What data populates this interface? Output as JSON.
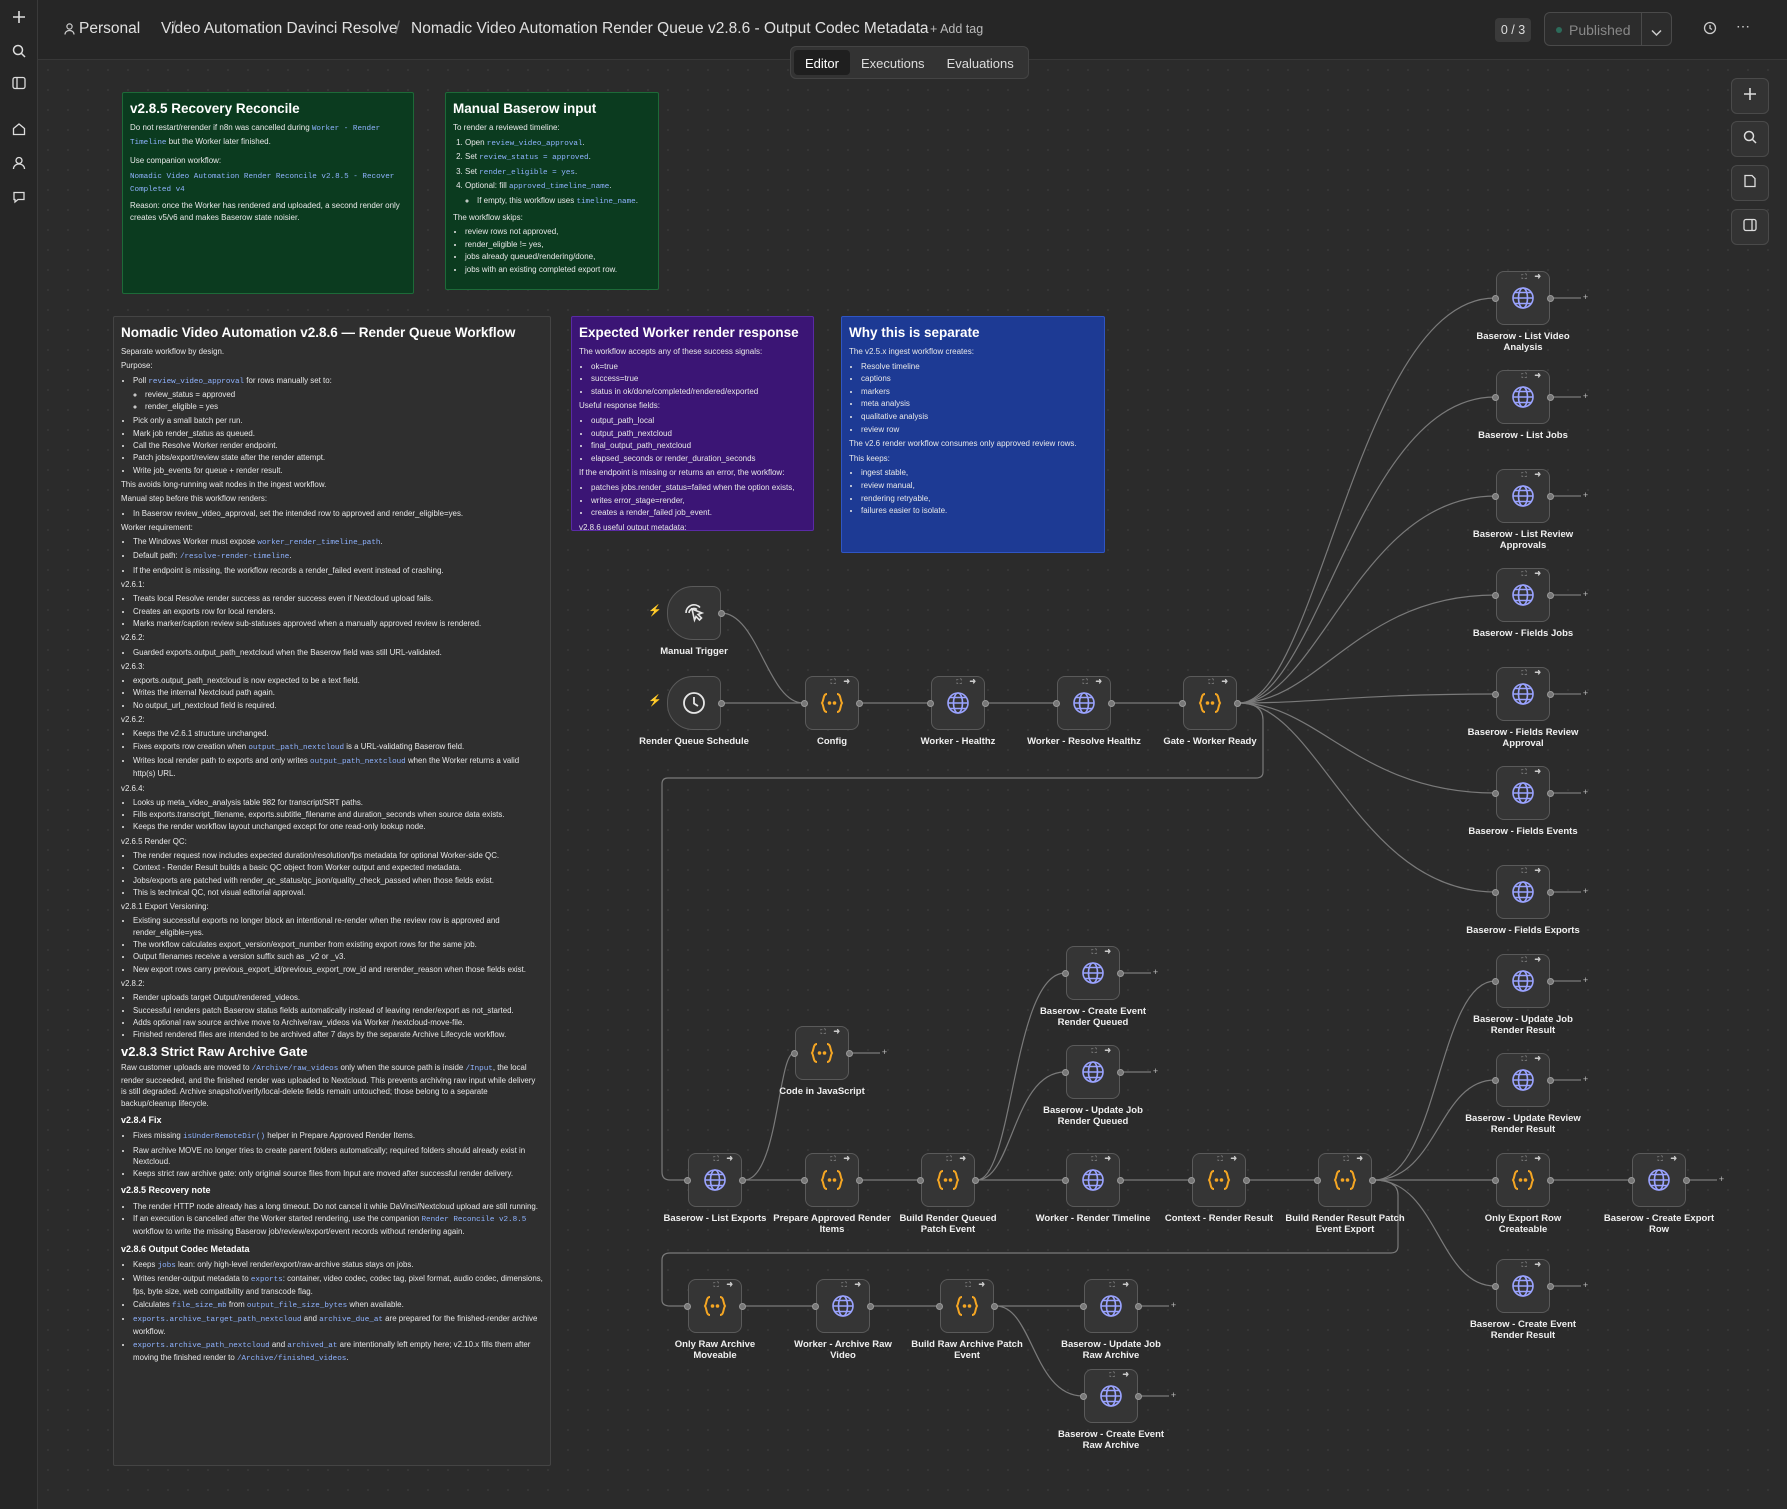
{
  "header": {
    "workspace": "Personal",
    "project": "Video Automation Davinci Resolve",
    "workflow_title": "Nomadic Video Automation Render Queue v2.8.6 - Output Codec Metadata",
    "add_tag": "+ Add tag",
    "counter": "0 / 3",
    "published": "Published"
  },
  "tabs": [
    "Editor",
    "Executions",
    "Evaluations"
  ],
  "sidebar_icons": [
    "plus-icon",
    "search-icon",
    "panel-icon",
    "home-icon",
    "user-icon",
    "chat-icon"
  ],
  "right_toolbar_icons": [
    "plus-icon",
    "search-icon",
    "sticky-note-icon",
    "panel-right-icon"
  ],
  "colors": {
    "green_note": "#0b3b1f",
    "purple_note": "#3b1575",
    "blue_note": "#1d3a94",
    "dark_note": "#2f2f2f",
    "code_icon": "#f5a623",
    "http_icon": "#9aa3ff"
  },
  "notes": {
    "recovery": {
      "title": "v2.8.5 Recovery Reconcile",
      "p1a": "Do not restart/rerender if n8n was cancelled during ",
      "p1code": "Worker - Render Timeline",
      "p1b": " but the Worker later finished.",
      "p2": "Use companion workflow:",
      "p2code": "Nomadic Video Automation Render Reconcile v2.8.5 - Recover Completed v4",
      "p3": "Reason: once the Worker has rendered and uploaded, a second render only creates v5/v6 and makes Baserow state noisier."
    },
    "manual": {
      "title": "Manual Baserow input",
      "intro": "To render a reviewed timeline:",
      "steps": [
        [
          "Open ",
          "review_video_approval",
          "."
        ],
        [
          "Set ",
          "review_status = approved",
          "."
        ],
        [
          "Set ",
          "render_eligible = yes",
          "."
        ],
        [
          "Optional: fill ",
          "approved_timeline_name",
          "."
        ]
      ],
      "sub": [
        "If empty, this workflow uses ",
        "timeline_name",
        "."
      ],
      "skips_title": "The workflow skips:",
      "skips": [
        "review rows not approved,",
        "render_eligible != yes,",
        "jobs already queued/rendering/done,",
        "jobs with an existing completed export row."
      ]
    },
    "expected": {
      "title": "Expected Worker render response",
      "intro": "The workflow accepts any of these success signals:",
      "signals": [
        "ok=true",
        "success=true",
        "status in ok/done/completed/rendered/exported"
      ],
      "fields_title": "Useful response fields:",
      "fields": [
        "output_path_local",
        "output_path_nextcloud",
        "final_output_path_nextcloud",
        "elapsed_seconds or render_duration_seconds"
      ],
      "error_title": "If the endpoint is missing or returns an error, the workflow:",
      "errors": [
        "patches jobs.render_status=failed when the option exists,",
        "writes error_stage=render,",
        "creates a render_failed job_event."
      ],
      "tail": "v2.8.6 useful output metadata:"
    },
    "why": {
      "title": "Why this is separate",
      "intro": "The v2.5.x ingest workflow creates:",
      "creates": [
        "Resolve timeline",
        "captions",
        "markers",
        "meta analysis",
        "qualitative analysis",
        "review row"
      ],
      "consumes": "The v2.6 render workflow consumes only approved review rows.",
      "keeps_title": "This keeps:",
      "keeps": [
        "ingest stable,",
        "review manual,",
        "rendering retryable,",
        "failures easier to isolate."
      ]
    },
    "main": {
      "title": "Nomadic Video Automation v2.8.6 — Render Queue Workflow",
      "separate": "Separate workflow by design.",
      "purpose": "Purpose:",
      "poll_a": "Poll ",
      "poll_code": "review_video_approval",
      "poll_b": " for rows manually set to:",
      "poll_sub": [
        "review_status = approved",
        "render_eligible = yes"
      ],
      "purpose_items": [
        "Pick only a small batch per run.",
        "Mark job render_status as queued.",
        "Call the Resolve Worker render endpoint.",
        "Patch jobs/export/review state after the render attempt.",
        "Write job_events for queue + render result."
      ],
      "avoids": "This avoids long-running wait nodes in the ingest workflow.",
      "manual_step": "Manual step before this workflow renders:",
      "manual_items": [
        "In Baserow review_video_approval, set the intended row to approved and render_eligible=yes."
      ],
      "worker_req": "Worker requirement:",
      "wr1a": "The Windows Worker must expose ",
      "wr1code": "worker_render_timeline_path",
      "wr1b": ".",
      "wr2a": "Default path: ",
      "wr2code": "/resolve-render-timeline",
      "wr2b": ".",
      "wr3": "If the endpoint is missing, the workflow records a render_failed event instead of crashing.",
      "v261_title": "v2.6.1:",
      "v261": [
        "Treats local Resolve render success as render success even if Nextcloud upload fails.",
        "Creates an exports row for local renders.",
        "Marks marker/caption review sub-statuses approved when a manually approved review is rendered."
      ],
      "v262a_title": "v2.6.2:",
      "v262a": [
        "Guarded exports.output_path_nextcloud when the Baserow field was still URL-validated."
      ],
      "v263_title": "v2.6.3:",
      "v263": [
        "exports.output_path_nextcloud is now expected to be a text field.",
        "Writes the internal Nextcloud path again.",
        "No output_url_nextcloud field is required."
      ],
      "v262b_title": "v2.6.2:",
      "v262b1": "Keeps the v2.6.1 structure unchanged.",
      "v262b2a": "Fixes exports row creation when ",
      "v262b2code": "output_path_nextcloud",
      "v262b2b": " is a URL-validating Baserow field.",
      "v262b3a": "Writes local render path to exports and only writes ",
      "v262b3code": "output_path_nextcloud",
      "v262b3b": " when the Worker returns a valid http(s) URL.",
      "v264_title": "v2.6.4:",
      "v264": [
        "Looks up meta_video_analysis table 982 for transcript/SRT paths.",
        "Fills exports.transcript_filename, exports.subtitle_filename and duration_seconds when source data exists.",
        "Keeps the render workflow layout unchanged except for one read-only lookup node."
      ],
      "v265_title": "v2.6.5 Render QC:",
      "v265": [
        "The render request now includes expected duration/resolution/fps metadata for optional Worker-side QC.",
        "Context - Render Result builds a basic QC object from Worker output and expected metadata.",
        "Jobs/exports are patched with render_qc_status/qc_json/quality_check_passed when those fields exist.",
        "This is technical QC, not visual editorial approval."
      ],
      "v281_title": "v2.8.1 Export Versioning:",
      "v281": [
        "Existing successful exports no longer block an intentional re-render when the review row is approved and render_eligible=yes.",
        "The workflow calculates export_version/export_number from existing export rows for the same job.",
        "Output filenames receive a version suffix such as _v2 or _v3.",
        "New export rows carry previous_export_id/previous_export_row_id and rerender_reason when those fields exist."
      ],
      "v282_title": "v2.8.2:",
      "v282": [
        "Render uploads target Output/rendered_videos.",
        "Successful renders patch Baserow status fields automatically instead of leaving render/export as not_started.",
        "Adds optional raw source archive move to Archive/raw_videos via Worker /nextcloud-move-file.",
        "Finished rendered files are intended to be archived after 7 days by the separate Archive Lifecycle workflow."
      ],
      "v283_title": "v2.8.3 Strict Raw Archive Gate",
      "v283a": "Raw customer uploads are moved to ",
      "v283code1": "/Archive/raw_videos",
      "v283b": " only when the source path is inside ",
      "v283code2": "/Input",
      "v283c": ", the local render succeeded, and the finished render was uploaded to Nextcloud. This prevents archiving raw input while delivery is still degraded. Archive snapshot/verify/local-delete fields remain untouched; those belong to a separate backup/cleanup lifecycle.",
      "v284_title": "v2.8.4 Fix",
      "v284_1a": "Fixes missing ",
      "v284_1code": "isUnderRemoteDir()",
      "v284_1b": " helper in Prepare Approved Render Items.",
      "v284_2": "Raw archive MOVE no longer tries to create parent folders automatically; required folders should already exist in Nextcloud.",
      "v284_3": "Keeps strict raw archive gate: only original source files from Input are moved after successful render delivery.",
      "v285_title": "v2.8.5 Recovery note",
      "v285_1": "The render HTTP node already has a long timeout. Do not cancel it while DaVinci/Nextcloud upload are still running.",
      "v285_2a": "If an execution is cancelled after the Worker started rendering, use the companion ",
      "v285_2code": "Render Reconcile v2.8.5",
      "v285_2b": " workflow to write the missing Baserow job/review/export/event records without rendering again.",
      "v286_title": "v2.8.6 Output Codec Metadata",
      "v286_1a": "Keeps ",
      "v286_1code": "jobs",
      "v286_1b": " lean: only high-level render/export/raw-archive status stays on jobs.",
      "v286_2a": "Writes render-output metadata to ",
      "v286_2code": "exports",
      "v286_2b": ": container, video codec, codec tag, pixel format, audio codec, dimensions, fps, byte size, web compatibility and transcode flag.",
      "v286_3a": "Calculates ",
      "v286_3code1": "file_size_mb",
      "v286_3b": " from ",
      "v286_3code2": "output_file_size_bytes",
      "v286_3c": " when available.",
      "v286_4code1": "exports.archive_target_path_nextcloud",
      "v286_4a": " and ",
      "v286_4code2": "archive_due_at",
      "v286_4b": " are prepared for the finished-render archive workflow.",
      "v286_5code1": "exports.archive_path_nextcloud",
      "v286_5a": " and ",
      "v286_5code2": "archived_at",
      "v286_5b": " are intentionally left empty here; v2.10.x fills them after moving the finished render to ",
      "v286_5code3": "/Archive/finished_videos",
      "v286_5c": "."
    }
  },
  "nodes": {
    "manual_trigger": "Manual Trigger",
    "schedule": "Render Queue Schedule",
    "config": "Config",
    "worker_healthz": "Worker - Healthz",
    "worker_resolve_healthz": "Worker - Resolve Healthz",
    "gate_worker_ready": "Gate - Worker Ready",
    "list_video_analysis": "Baserow - List Video Analysis",
    "list_jobs": "Baserow - List Jobs",
    "list_review_approvals": "Baserow - List Review Approvals",
    "fields_jobs": "Baserow - Fields Jobs",
    "fields_review_approval": "Baserow - Fields Review Approval",
    "fields_events": "Baserow - Fields Events",
    "fields_exports": "Baserow - Fields Exports",
    "create_event_render_queued": "Baserow - Create Event Render Queued",
    "update_job_render_queued": "Baserow - Update Job Render Queued",
    "code_js": "Code in JavaScript",
    "list_exports": "Baserow - List Exports",
    "prepare_items": "Prepare Approved Render Items",
    "build_queued_patch": "Build Render Queued Patch Event",
    "worker_render_timeline": "Worker - Render Timeline",
    "context_render_result": "Context - Render Result",
    "build_result_patch": "Build Render Result Patch Event Export",
    "update_job_render_result": "Baserow - Update Job Render Result",
    "update_review_render_result": "Baserow - Update Review Render Result",
    "only_export_createable": "Only Export Row Createable",
    "create_export_row": "Baserow - Create Export Row",
    "create_event_render_result": "Baserow - Create Event Render Result",
    "only_raw_archive": "Only Raw Archive Moveable",
    "worker_archive_raw": "Worker - Archive Raw Video",
    "build_raw_archive_patch": "Build Raw Archive Patch Event",
    "update_job_raw_archive": "Baserow - Update Job Raw Archive",
    "create_event_raw_archive": "Baserow - Create Event Raw Archive"
  }
}
